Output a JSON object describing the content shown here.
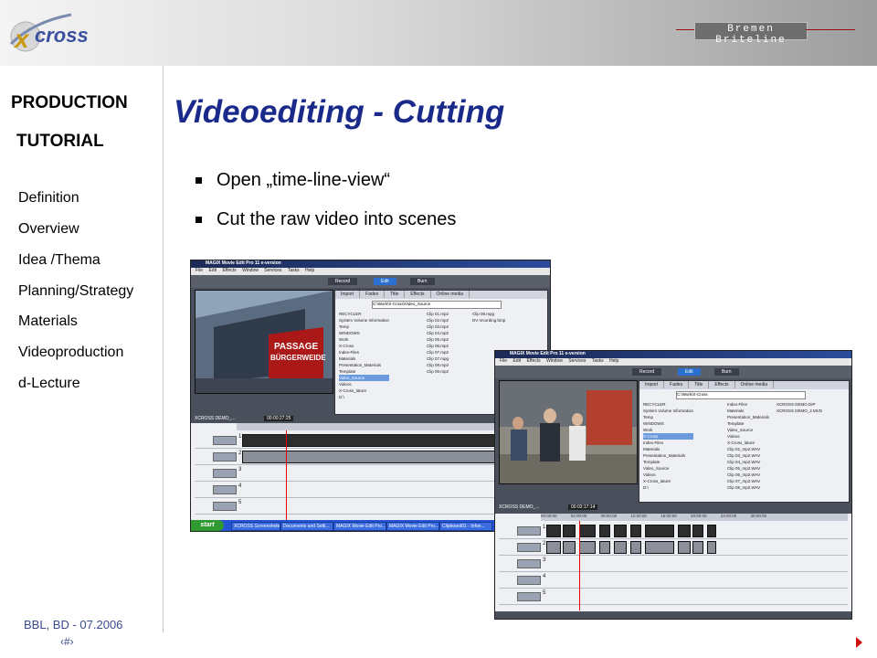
{
  "header": {
    "logo_text": "X-CROSS",
    "brand": "Bremen Briteline"
  },
  "sidebar": {
    "heading_line1": "PRODUCTION",
    "heading_line2": "TUTORIAL",
    "items": [
      {
        "label": "Definition"
      },
      {
        "label": "Overview"
      },
      {
        "label": "Idea /Thema"
      },
      {
        "label": "Planning/Strategy"
      },
      {
        "label": "Materials"
      },
      {
        "label": "Videoproduction"
      },
      {
        "label": "d-Lecture"
      }
    ]
  },
  "slide": {
    "title": "Videoediting - Cutting",
    "bullets": [
      "Open „time-line-view“",
      "Cut the raw video into scenes"
    ]
  },
  "footer": {
    "credit": "BBL, BD - 07.2006",
    "page": "‹#›"
  },
  "screenshot1": {
    "app_title": "MAGIX  Movie Edit Pro 11 e-version",
    "menu": [
      "File",
      "Edit",
      "Effects",
      "Window",
      "Services",
      "Tasks",
      "Help"
    ],
    "mode_buttons": [
      "Record",
      "Edit",
      "Burn"
    ],
    "tabs": [
      "Import",
      "Fades",
      "Title",
      "Effects",
      "Online media"
    ],
    "path": "C:\\Work\\X-Cross\\Video_Source",
    "tree": [
      "RECYCLER",
      "System Volume Information",
      "Temp",
      "WINDOWS",
      "Work",
      "X-Cross",
      "Index-Files",
      "Materials",
      "Presentation_Materials",
      "Template",
      "Video_Source",
      "Videos",
      "X-Cross_lature",
      "D:\\"
    ],
    "files": [
      "Clip 01.mp2",
      "Clip 02.mp2",
      "Clip 03.mp2",
      "Clip 04.mp2",
      "Clip 05.mp2",
      "Clip 06.mp2",
      "Clip 07.mp2",
      "Clip 07.mpg",
      "Clip 08.mp2",
      "Clip 09.mp2"
    ],
    "files2": [
      "Clip 09.mpg",
      "DV recording.bmp"
    ],
    "project": "XCROSS DEMO_...",
    "time": "00:00:27:25",
    "taskbar": [
      "start",
      "XCROSS Screenshots",
      "Documents and Setti...",
      "MAGIX Movie Edit Pro...",
      "MAGIX Movie Edit Pro...",
      "Clipboard01 - Infan..."
    ]
  },
  "screenshot2": {
    "app_title": "MAGIX  Movie Edit Pro 11 e-version",
    "menu": [
      "File",
      "Edit",
      "Effects",
      "Window",
      "Services",
      "Tasks",
      "Help"
    ],
    "mode_buttons": [
      "Record",
      "Edit",
      "Burn"
    ],
    "tabs": [
      "Import",
      "Fades",
      "Title",
      "Effects",
      "Online media"
    ],
    "path": "C:\\Work\\X-Cross",
    "tree": [
      "RECYCLER",
      "System Volume Information",
      "Temp",
      "WINDOWS",
      "Work",
      "X-Cross",
      "Index-Files",
      "Materials",
      "Presentation_Materials",
      "Template",
      "Video_Source",
      "Videos",
      "X-Cross_lature",
      "D:\\"
    ],
    "files": [
      "Index-Files",
      "Materials",
      "Presentation_Materials",
      "Template",
      "Video_Source",
      "Videos",
      "X-Cross_lature",
      "Clip 02_mp2.WAV",
      "Clip 03_mp2.WAV",
      "Clip 04_mp2.WAV",
      "Clip 05_mp2.WAV",
      "Clip 06_mp2.WAV",
      "Clip 07_mp2.WAV",
      "Clip 08_mp2.WAV"
    ],
    "files2": [
      "XCROSS DEMO.DIP",
      "XCROSS DEMO_2.MVD"
    ],
    "project": "XCROSS DEMO_...",
    "time": "00:02:17:14",
    "ruler": [
      "00:00:00",
      "04:00:00",
      "08:00:00",
      "12:00:00",
      "16:00:00",
      "20:00:00",
      "24:00:00",
      "28:00:00"
    ]
  }
}
